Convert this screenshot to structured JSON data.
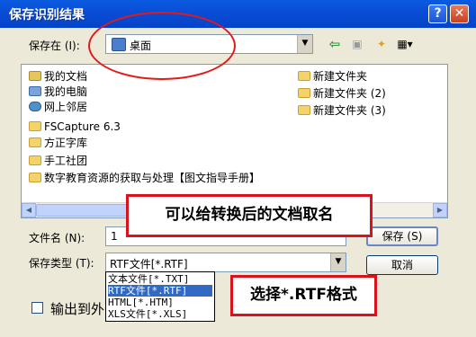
{
  "window": {
    "title": "保存识别结果",
    "help_label": "?",
    "close_label": "✕"
  },
  "look_in": {
    "label": "保存在 (I):",
    "value": "桌面"
  },
  "toolbar": {
    "back_icon": "back-arrow-icon",
    "up_icon": "up-folder-icon",
    "new_folder_icon": "new-folder-icon",
    "view_menu_icon": "view-menu-icon"
  },
  "files": [
    {
      "name": "我的文档",
      "icon": "doc"
    },
    {
      "name": "我的电脑",
      "icon": "pc"
    },
    {
      "name": "网上邻居",
      "icon": "net"
    },
    {
      "name": "FSCapture 6.3",
      "icon": "folder"
    },
    {
      "name": "方正字库",
      "icon": "folder"
    },
    {
      "name": "手工社团",
      "icon": "folder"
    },
    {
      "name": "数字教育资源的获取与处理【图文指导手册】",
      "icon": "folder"
    },
    {
      "name": "新建文件夹",
      "icon": "folder"
    },
    {
      "name": "新建文件夹 (2)",
      "icon": "folder"
    },
    {
      "name": "新建文件夹 (3)",
      "icon": "folder"
    }
  ],
  "filename": {
    "label": "文件名 (N):",
    "value": "1"
  },
  "filetype": {
    "label": "保存类型 (T):",
    "value": "RTF文件[*.RTF]",
    "options": [
      "文本文件[*.TXT]",
      "RTF文件[*.RTF]",
      "HTML[*.HTM]",
      "XLS文件[*.XLS]"
    ],
    "selected_index": 1
  },
  "buttons": {
    "save": "保存 (S)",
    "cancel": "取消"
  },
  "checkbox": {
    "label": "输出到外"
  },
  "annotations": {
    "callout1": "可以给转换后的文档取名",
    "callout2": "选择*.RTF格式",
    "highlight_color": "#d9131b"
  }
}
